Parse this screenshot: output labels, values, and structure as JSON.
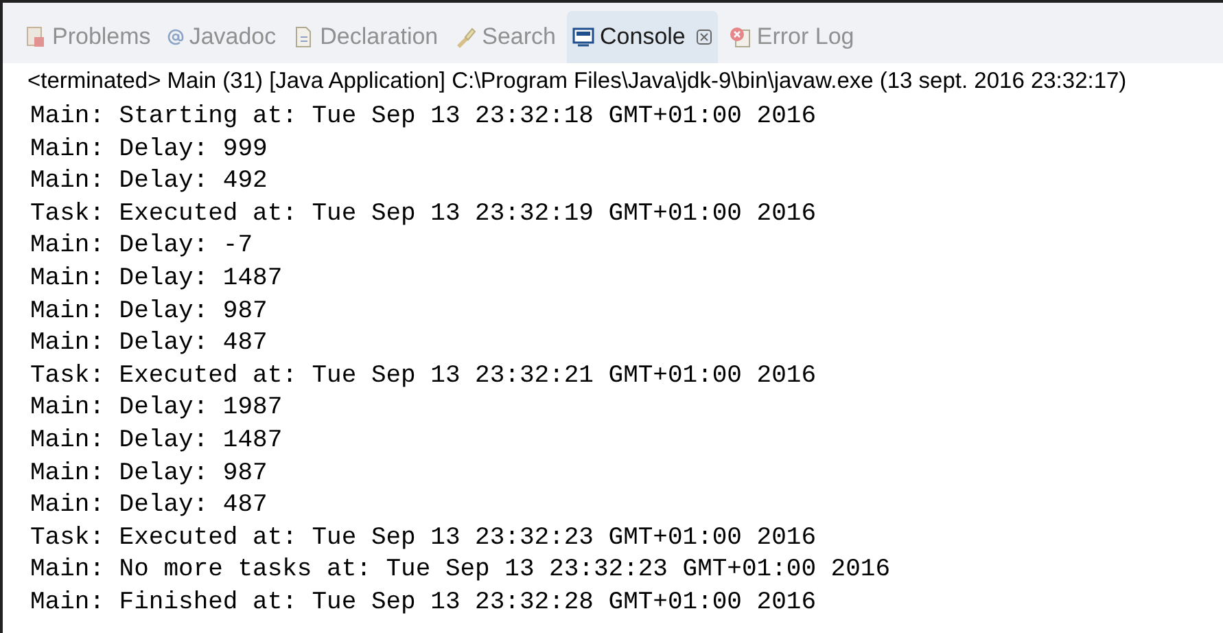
{
  "tabs": [
    {
      "label": "Problems",
      "kind": "problems",
      "selected": false
    },
    {
      "label": "Javadoc",
      "kind": "at",
      "selected": false
    },
    {
      "label": "Declaration",
      "kind": "declaration",
      "selected": false
    },
    {
      "label": "Search",
      "kind": "search",
      "selected": false
    },
    {
      "label": "Console",
      "kind": "console",
      "selected": true
    },
    {
      "label": "Error Log",
      "kind": "errorlog",
      "selected": false
    }
  ],
  "status": "<terminated> Main (31) [Java Application] C:\\Program Files\\Java\\jdk-9\\bin\\javaw.exe (13 sept. 2016 23:32:17)",
  "console_lines": [
    "Main: Starting at: Tue Sep 13 23:32:18 GMT+01:00 2016",
    "Main: Delay: 999",
    "Main: Delay: 492",
    "Task: Executed at: Tue Sep 13 23:32:19 GMT+01:00 2016",
    "Main: Delay: -7",
    "Main: Delay: 1487",
    "Main: Delay: 987",
    "Main: Delay: 487",
    "Task: Executed at: Tue Sep 13 23:32:21 GMT+01:00 2016",
    "Main: Delay: 1987",
    "Main: Delay: 1487",
    "Main: Delay: 987",
    "Main: Delay: 487",
    "Task: Executed at: Tue Sep 13 23:32:23 GMT+01:00 2016",
    "Main: No more tasks at: Tue Sep 13 23:32:23 GMT+01:00 2016",
    "Main: Finished at: Tue Sep 13 23:32:28 GMT+01:00 2016"
  ]
}
